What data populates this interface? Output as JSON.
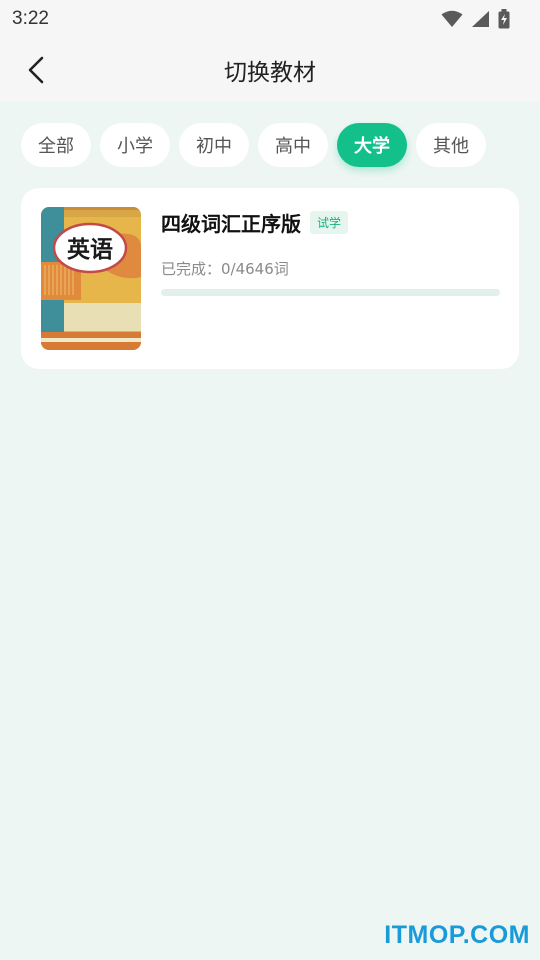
{
  "status": {
    "time": "3:22"
  },
  "header": {
    "title": "切换教材"
  },
  "tabs": [
    {
      "label": "全部",
      "active": false
    },
    {
      "label": "小学",
      "active": false
    },
    {
      "label": "初中",
      "active": false
    },
    {
      "label": "高中",
      "active": false
    },
    {
      "label": "大学",
      "active": true
    },
    {
      "label": "其他",
      "active": false
    }
  ],
  "book": {
    "cover_text": "英语",
    "title": "四级词汇正序版",
    "tag": "试学",
    "progress_label": "已完成：0/4646词",
    "completed": 0,
    "total": 4646
  },
  "watermark": "ITMOP.COM",
  "colors": {
    "accent": "#13c08a",
    "background": "#eef6f3",
    "tag_text": "#17b07f"
  }
}
